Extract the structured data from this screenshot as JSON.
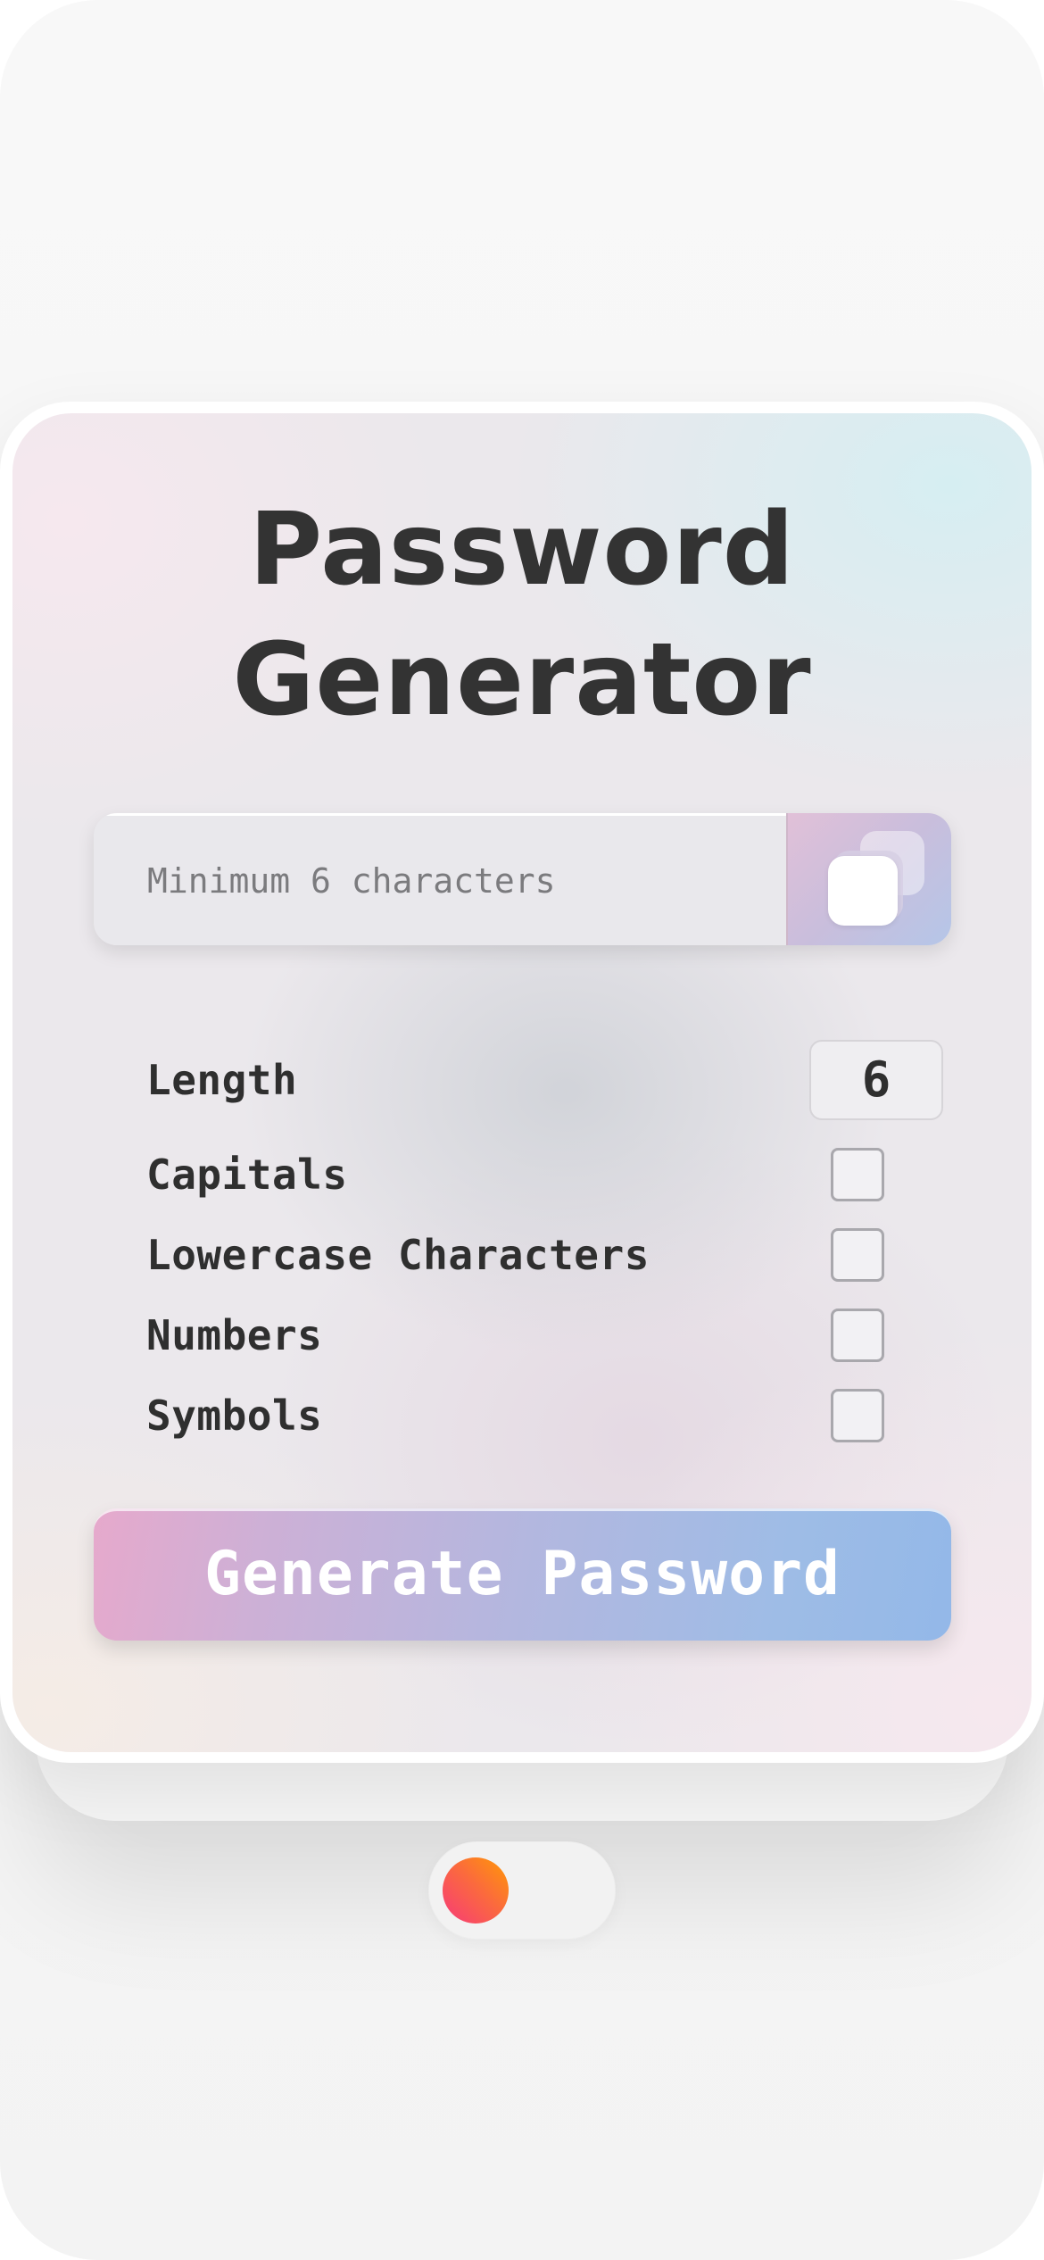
{
  "app": {
    "title_line1": "Password",
    "title_line2": "Generator"
  },
  "output": {
    "placeholder": "Minimum 6 characters",
    "value": "",
    "copy_icon": "copy-icon"
  },
  "options": {
    "length": {
      "label": "Length",
      "value": "6"
    },
    "capitals": {
      "label": "Capitals",
      "checked": false
    },
    "lowercase": {
      "label": "Lowercase Characters",
      "checked": false
    },
    "numbers": {
      "label": "Numbers",
      "checked": false
    },
    "symbols": {
      "label": "Symbols",
      "checked": false
    }
  },
  "generate_button": {
    "label": "Generate Password"
  },
  "theme_toggle": {
    "state": "off",
    "knob_colors": [
      "#f73a7a",
      "#ff9a05"
    ]
  }
}
